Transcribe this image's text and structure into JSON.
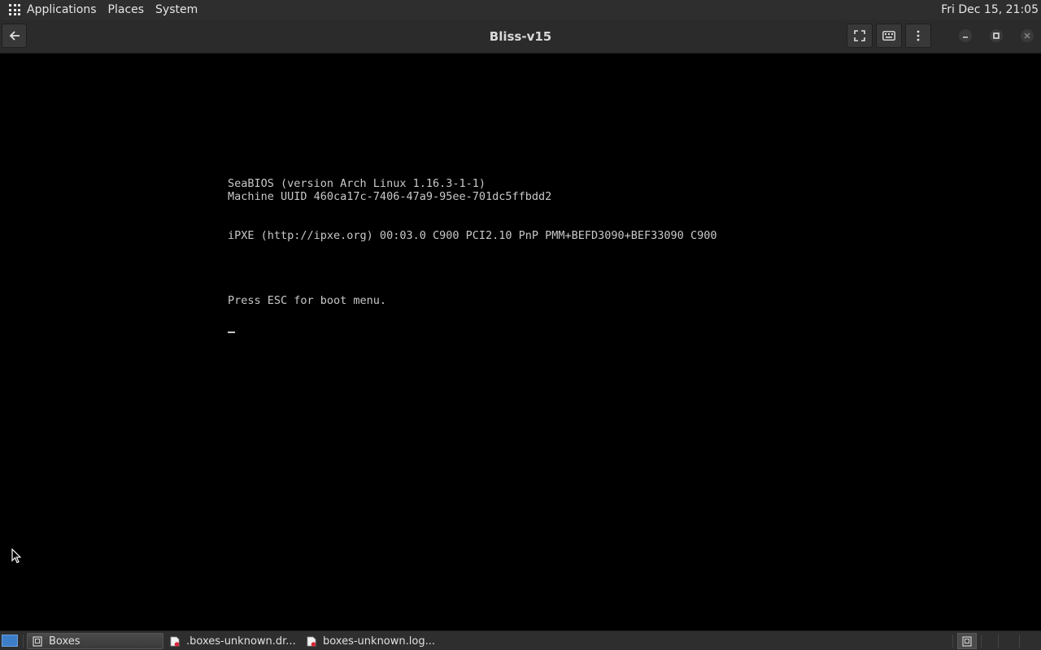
{
  "top_panel": {
    "menus": [
      "Applications",
      "Places",
      "System"
    ],
    "clock": "Fri Dec 15, 21:05"
  },
  "headerbar": {
    "title": "Bliss-v15",
    "buttons": [
      "back-icon",
      "fullscreen-icon",
      "keyboard-icon",
      "menu-icon"
    ],
    "window_controls": [
      "minimize-icon",
      "maximize-icon",
      "close-icon"
    ]
  },
  "console": {
    "line1": "SeaBIOS (version Arch Linux 1.16.3-1-1)",
    "line2": "Machine UUID 460ca17c-7406-47a9-95ee-701dc5ffbdd2",
    "line3": "iPXE (http://ipxe.org) 00:03.0 C900 PCI2.10 PnP PMM+BEFD3090+BEF33090 C900",
    "line4": "Press ESC for boot menu."
  },
  "taskbar": {
    "tasks": [
      {
        "label": "Boxes",
        "active": true
      },
      {
        "label": ".boxes-unknown.dr...",
        "active": false
      },
      {
        "label": "boxes-unknown.log...",
        "active": false
      }
    ]
  },
  "colors": {
    "panel": "#2e2e2e",
    "header": "#2b2b2b",
    "console_text": "#c8c8c8",
    "desktop_button": "#3c7ec8"
  }
}
